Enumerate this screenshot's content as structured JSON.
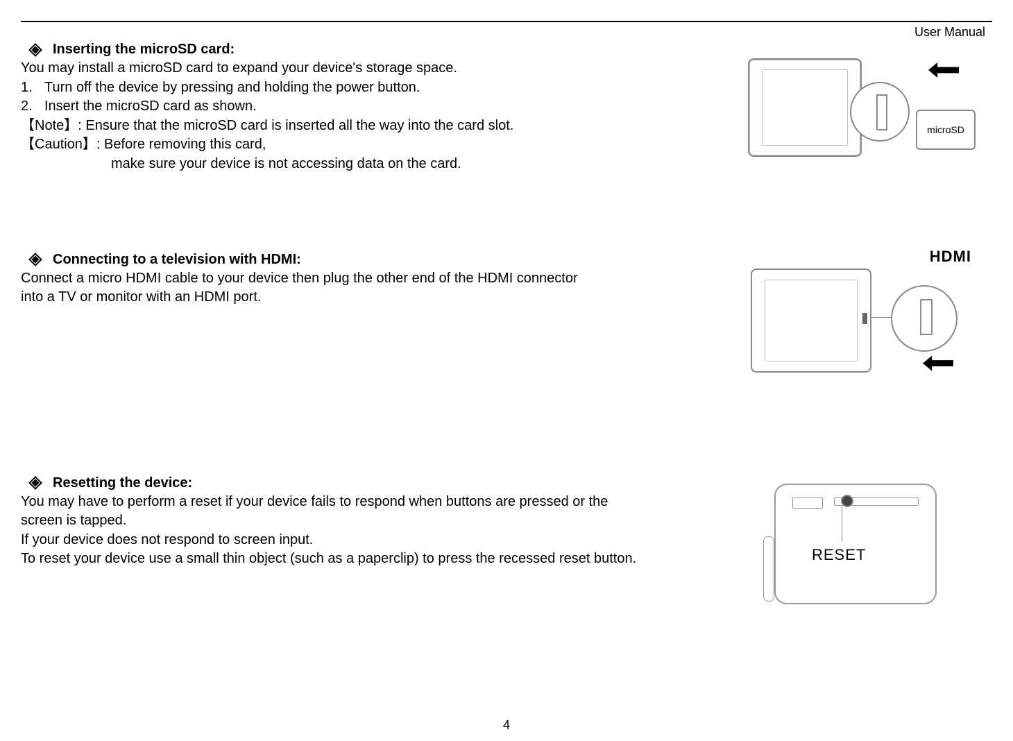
{
  "header": {
    "label": "User Manual"
  },
  "footer": {
    "page_number": "4"
  },
  "section1": {
    "title": "Inserting the microSD card:",
    "intro": "You may install a microSD card to expand your device's storage space.",
    "step1_num": "1.",
    "step1": "Turn off the device by pressing and holding the power button.",
    "step2_num": "2.",
    "step2": "Insert the microSD card as shown.",
    "note_label": "【Note】",
    "note_text": ": Ensure that the microSD card is inserted all the way into the card slot.",
    "caution_label": "【Caution】",
    "caution_line1": ": Before removing this card,",
    "caution_line2": "make sure your device is not accessing data on the card.",
    "sd_label": "microSD"
  },
  "section2": {
    "title": "Connecting to a television with HDMI:",
    "body": "Connect a micro HDMI cable to your device then plug the other end of the HDMI connector into a TV or monitor with an HDMI port.",
    "hdmi_logo": "HDMI"
  },
  "section3": {
    "title": "Resetting the device:",
    "line1": "You may have to perform a reset if your device fails to respond when buttons are pressed or the screen is tapped.",
    "line2": "If your device does not respond to screen input.",
    "line3": "To reset your device use a small thin object (such as a paperclip) to press the recessed reset button.",
    "reset_label": "RESET"
  }
}
